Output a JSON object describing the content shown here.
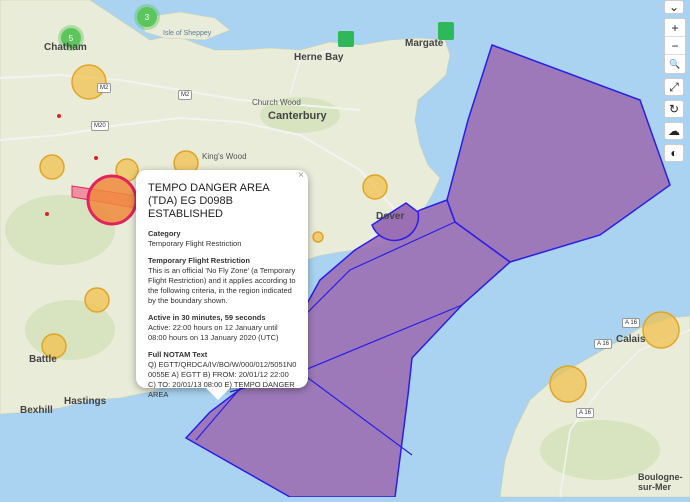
{
  "places": {
    "chatham": "Chatham",
    "sheppey": "Isle of Sheppey",
    "herne_bay": "Herne Bay",
    "margate": "Margate",
    "canterbury": "Canterbury",
    "church_wood": "Church Wood",
    "kings_wood": "King's Wood",
    "dover": "Dover",
    "battle": "Battle",
    "hastings": "Hastings",
    "bexhill": "Bexhill",
    "calais": "Calais",
    "boulogne": "Boulogne-\nsur-Mer"
  },
  "roads": [
    "M2",
    "M2",
    "M20",
    "A 16",
    "A 16",
    "A 16"
  ],
  "clusters": [
    "5",
    "3"
  ],
  "popup": {
    "close": "×",
    "title": "TEMPO DANGER AREA (TDA) EG D098B ESTABLISHED",
    "category_heading": "Category",
    "category_value": "Temporary Flight Restriction",
    "tfr_heading": "Temporary Flight Restriction",
    "tfr_text": "This is an official 'No Fly Zone' (a Temporary Flight Restriction) and it applies according to the following criteria, in the region indicated by the boundary shown.",
    "active_heading": "Active in 30 minutes, 59 seconds",
    "active_text": "Active: 22:00 hours on 12 January until 08:00 hours on 13 January 2020 (UTC)",
    "notam_heading": "Full NOTAM Text",
    "notam_text": "Q) EGTT/QRDCA/IV/BO/W/000/012/5051N00055E A) EGTT B) FROM: 20/01/12 22:00 C) TO: 20/01/13 08:00 E) TEMPO DANGER AREA"
  },
  "controls": {
    "chevron": "⌄",
    "zoom_in": "+",
    "zoom_out": "−",
    "search": "🔍",
    "fullscreen": "⤢",
    "refresh": "↻",
    "weather": "☁",
    "contrast": "◐"
  },
  "colors": {
    "sea": "#a9d3f0",
    "land": "#e8ecd9",
    "restriction_fill": "#9b6fb3",
    "restriction_stroke": "#2a1ee8",
    "circle_fill": "#f2c14e",
    "danger_fill": "#f08a3c",
    "danger_stroke": "#e0245e",
    "cluster_green": "#5cc55c"
  }
}
